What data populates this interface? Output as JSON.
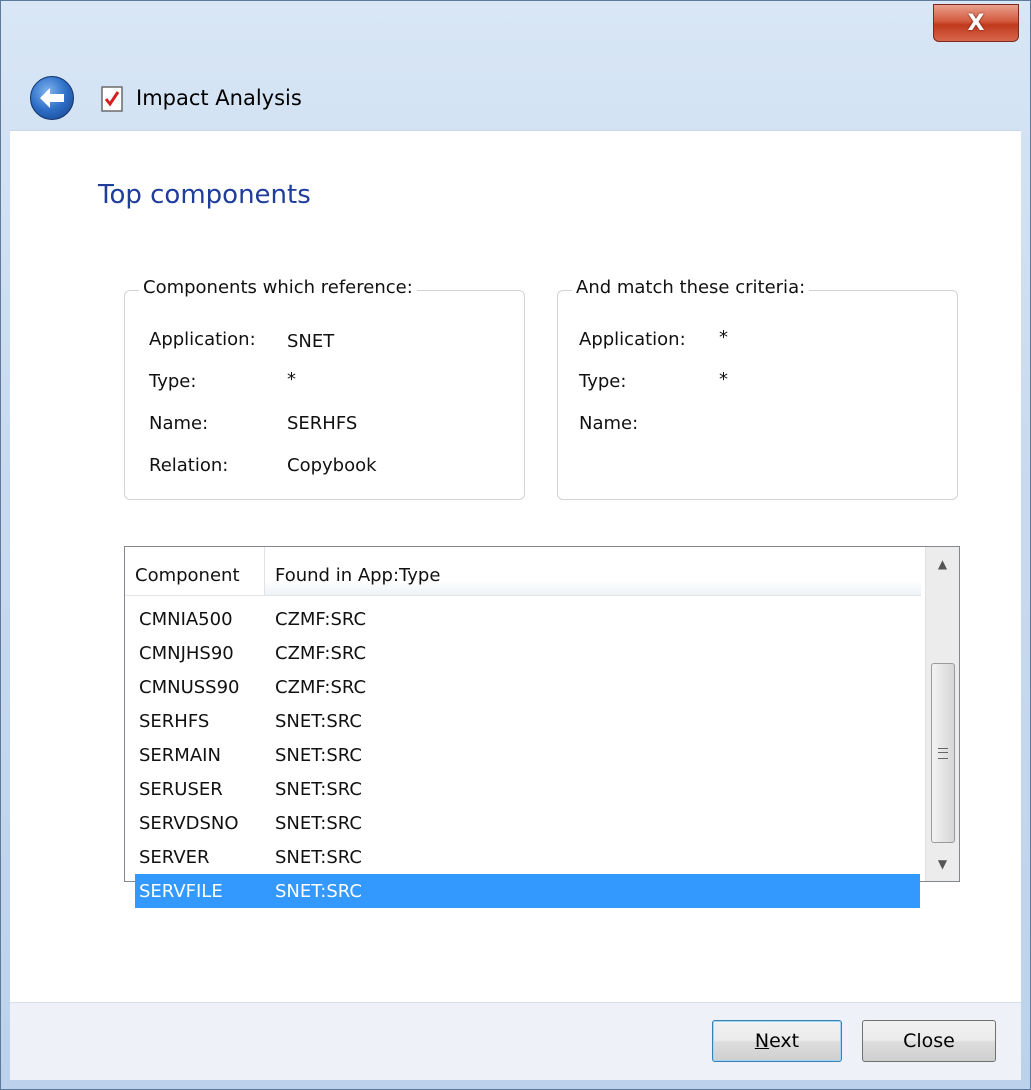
{
  "window": {
    "title": "Impact Analysis",
    "close_glyph": "X"
  },
  "page": {
    "heading": "Top components"
  },
  "reference_group": {
    "legend": "Components which reference:",
    "fields": [
      {
        "label": "Application:",
        "value": "SNET"
      },
      {
        "label": "Type:",
        "value": "*"
      },
      {
        "label": "Name:",
        "value": "SERHFS"
      },
      {
        "label": "Relation:",
        "value": "Copybook"
      }
    ]
  },
  "criteria_group": {
    "legend": "And match these criteria:",
    "fields": [
      {
        "label": "Application:",
        "value": "*"
      },
      {
        "label": "Type:",
        "value": "*"
      },
      {
        "label": "Name:",
        "value": ""
      }
    ]
  },
  "results": {
    "columns": [
      "Component",
      "Found in App:Type"
    ],
    "rows": [
      {
        "component": "CMNIA500",
        "found": "CZMF:SRC"
      },
      {
        "component": "CMNJHS90",
        "found": "CZMF:SRC"
      },
      {
        "component": "CMNUSS90",
        "found": "CZMF:SRC"
      },
      {
        "component": "SERHFS",
        "found": "SNET:SRC"
      },
      {
        "component": "SERMAIN",
        "found": "SNET:SRC"
      },
      {
        "component": "SERUSER",
        "found": "SNET:SRC"
      },
      {
        "component": "SERVDSNO",
        "found": "SNET:SRC"
      },
      {
        "component": "SERVER",
        "found": "SNET:SRC"
      },
      {
        "component": "SERVFILE",
        "found": "SNET:SRC"
      }
    ],
    "selected_row": "SERVFILE"
  },
  "buttons": {
    "next_mnemonic": "N",
    "next_rest": "ext",
    "close": "Close"
  },
  "icons": {
    "back": "back-arrow-icon",
    "document": "checked-document-icon",
    "close": "close-icon"
  },
  "colors": {
    "heading": "#1f3d9a",
    "selection": "#3399ff",
    "close_button": "#c0391d"
  }
}
